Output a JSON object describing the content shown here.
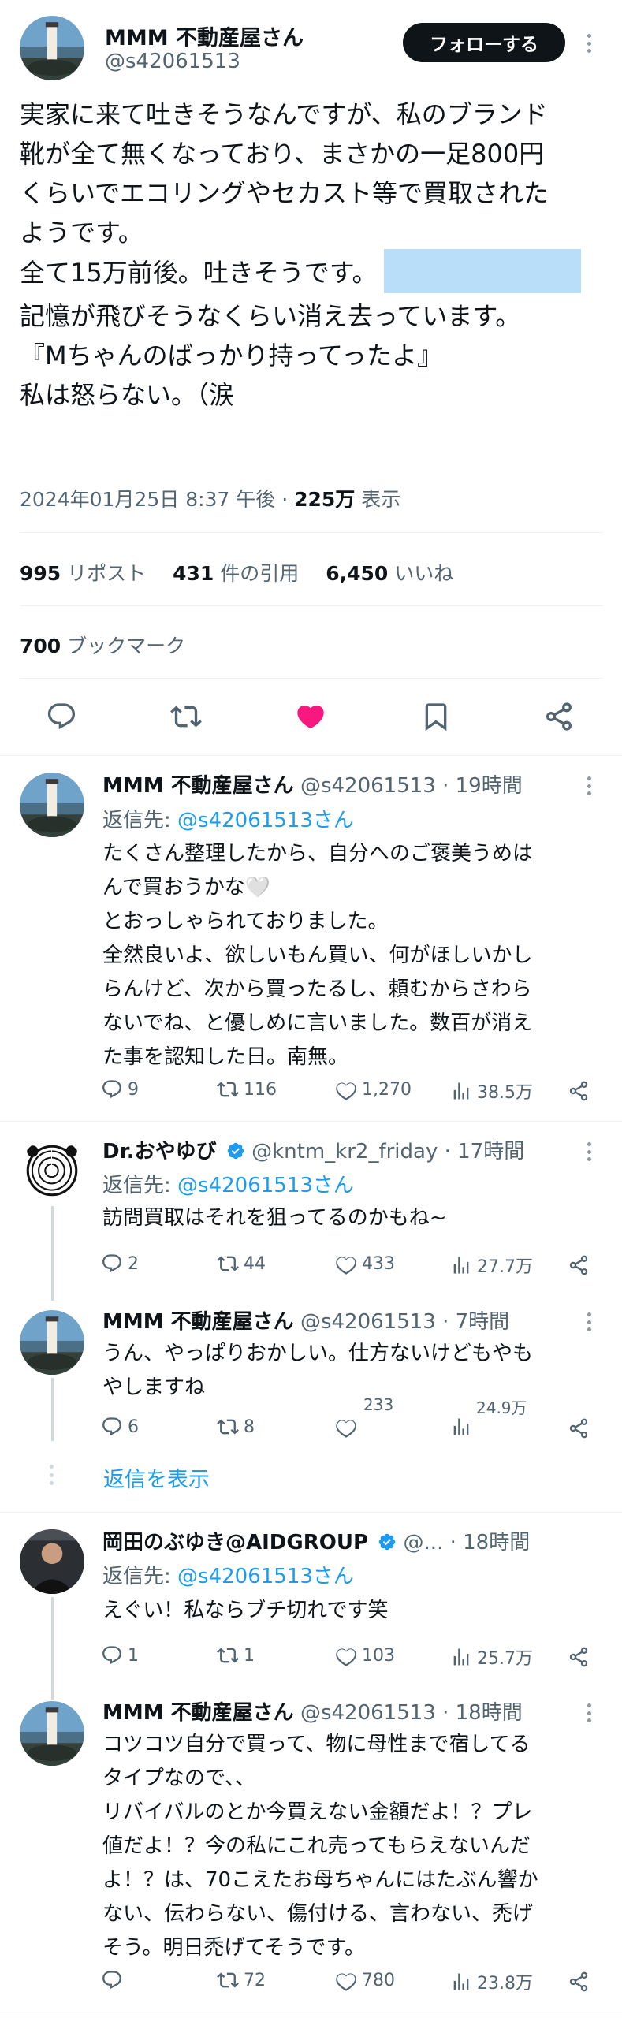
{
  "main_tweet": {
    "display_name": "MMM 不動産屋さん",
    "handle": "@s42061513",
    "follow_label": "フォローする",
    "lines": [
      "実家に来て吐きそうなんですが、私のブランド",
      "靴が全て無くなっており、まさかの一足800円",
      "くらいでエコリングやセカスト等で買取された",
      "ようです。",
      "全て15万前後。吐きそうです。",
      "記憶が飛びそうなくらい消え去っています。",
      "『Mちゃんのばっかり持ってったよ』",
      "私は怒らない。（涙"
    ],
    "timestamp": "2024年01月25日 8:37 午後 · ",
    "views_count": "225万",
    "views_label": " 表示",
    "reposts_count": "995",
    "reposts_label": "リポスト",
    "quotes_count": "431",
    "quotes_label": "件の引用",
    "likes_count": "6,450",
    "likes_label": "いいね",
    "bookmarks_count": "700",
    "bookmarks_label": "ブックマーク"
  },
  "replies": [
    {
      "display_name": "MMM 不動産屋さん",
      "handle_time": "@s42061513 · 19時間",
      "reply_to_prefix": "返信先: ",
      "reply_to": "@s42061513さん",
      "lines": [
        "たくさん整理したから、自分へのご褒美うめは",
        "んで買おうかな🤍",
        "とおっしゃられておりました。",
        "全然良いよ、欲しいもん買い、何がほしいかし",
        "らんけど、次から買ったるし、頼むからさわら",
        "ないでね、と優しめに言いました。数百が消え",
        "た事を認知した日。南無。"
      ],
      "replies": "9",
      "reposts": "116",
      "likes": "1,270",
      "views": "38.5万"
    },
    {
      "display_name": "Dr.おやゆび",
      "handle_time": "@kntm_kr2_friday · 17時間",
      "reply_to_prefix": "返信先: ",
      "reply_to": "@s42061513さん",
      "lines": [
        "訪問買取はそれを狙ってるのかもね~"
      ],
      "replies": "2",
      "reposts": "44",
      "likes": "433",
      "views": "27.7万"
    },
    {
      "display_name": "MMM 不動産屋さん",
      "handle_time": "@s42061513 · 7時間",
      "lines": [
        "うん、やっぱりおかしい。仕方ないけどもやも",
        "やしますね"
      ],
      "replies": "6",
      "reposts": "8",
      "likes": "233",
      "views": "24.9万"
    },
    {
      "show_replies": "返信を表示"
    },
    {
      "display_name": "岡田のぶゆき@AIDGROUP",
      "handle_time": "@... · 18時間",
      "reply_to_prefix": "返信先: ",
      "reply_to": "@s42061513さん",
      "lines": [
        "えぐい！私ならブチ切れです笑"
      ],
      "replies": "1",
      "reposts": "1",
      "likes": "103",
      "views": "25.7万"
    },
    {
      "display_name": "MMM 不動産屋さん",
      "handle_time": "@s42061513 · 18時間",
      "lines": [
        "コツコツ自分で買って、物に母性まで宿してる",
        "タイプなので、、",
        "リバイバルのとか今買えない金額だよ！？プレ",
        "値だよ！？今の私にこれ売ってもらえないんだ",
        "よ！？は、70こえたお母ちゃんにはたぶん響か",
        "ない、伝わらない、傷付ける、言わない、禿げ",
        "そう。明日禿げてそうです。"
      ],
      "replies": "",
      "reposts": "72",
      "likes": "780",
      "views": "23.8万"
    }
  ],
  "colors": {
    "accent": "#1d9bf0",
    "like": "#f91880",
    "muted": "#536471",
    "highlight": "#b8def9"
  }
}
